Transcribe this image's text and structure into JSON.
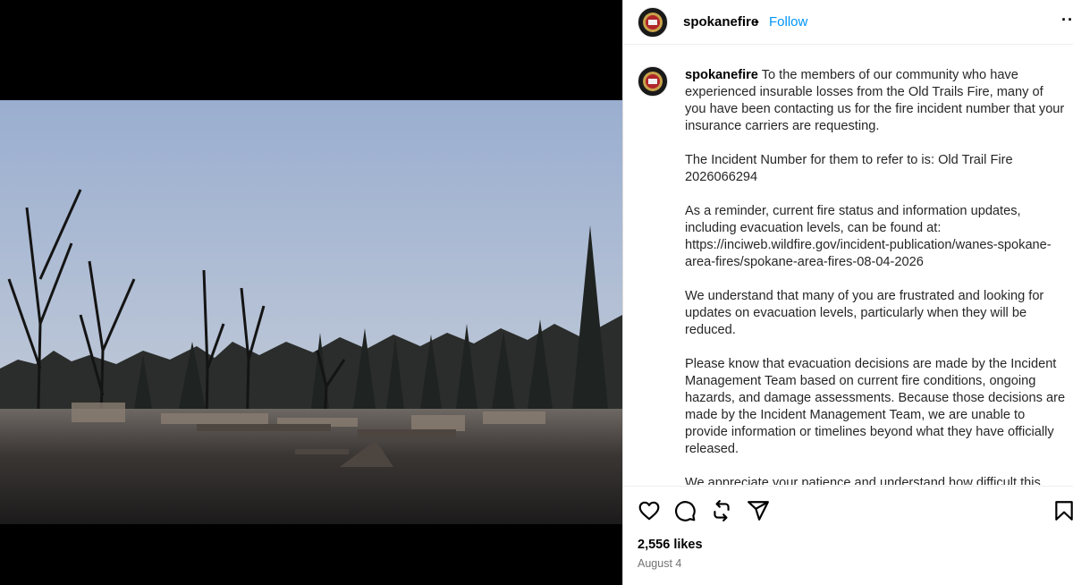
{
  "media": {
    "alt": "Burned area after wildfire"
  },
  "header": {
    "username": "spokanefire",
    "separator": "•",
    "follow_label": "Follow",
    "more_label": "··"
  },
  "caption": {
    "username": "spokanefire",
    "text": " To the members of our community who have experienced insurable losses from the Old Trails Fire, many of you have been contacting us for the fire incident number that your insurance carriers are requesting.\n\nThe Incident Number for them to refer to is: Old Trail Fire 2026066294\n\nAs a reminder, current fire status and information updates, including evacuation levels, can be found at: https://inciweb.wildfire.gov/incident-publication/wanes-spokane-area-fires/spokane-area-fires-08-04-2026\n\nWe understand that many of you are frustrated and looking for updates on evacuation levels, particularly when they will be reduced.\n\nPlease know that evacuation decisions are made by the Incident Management Team based on current fire conditions, ongoing hazards, and damage assessments. Because those decisions are made by the Incident Management Team, we are unable to provide information or timelines beyond what they have officially released.\n\nWe appreciate your patience and understand how difficult this"
  },
  "actions": {
    "like_icon": "heart-icon",
    "comment_icon": "comment-icon",
    "repost_icon": "repost-icon",
    "share_icon": "send-icon",
    "save_icon": "bookmark-icon",
    "likes": "2,556 likes",
    "date": "August 4"
  },
  "colors": {
    "follow": "#0095f6",
    "date": "#737373"
  }
}
